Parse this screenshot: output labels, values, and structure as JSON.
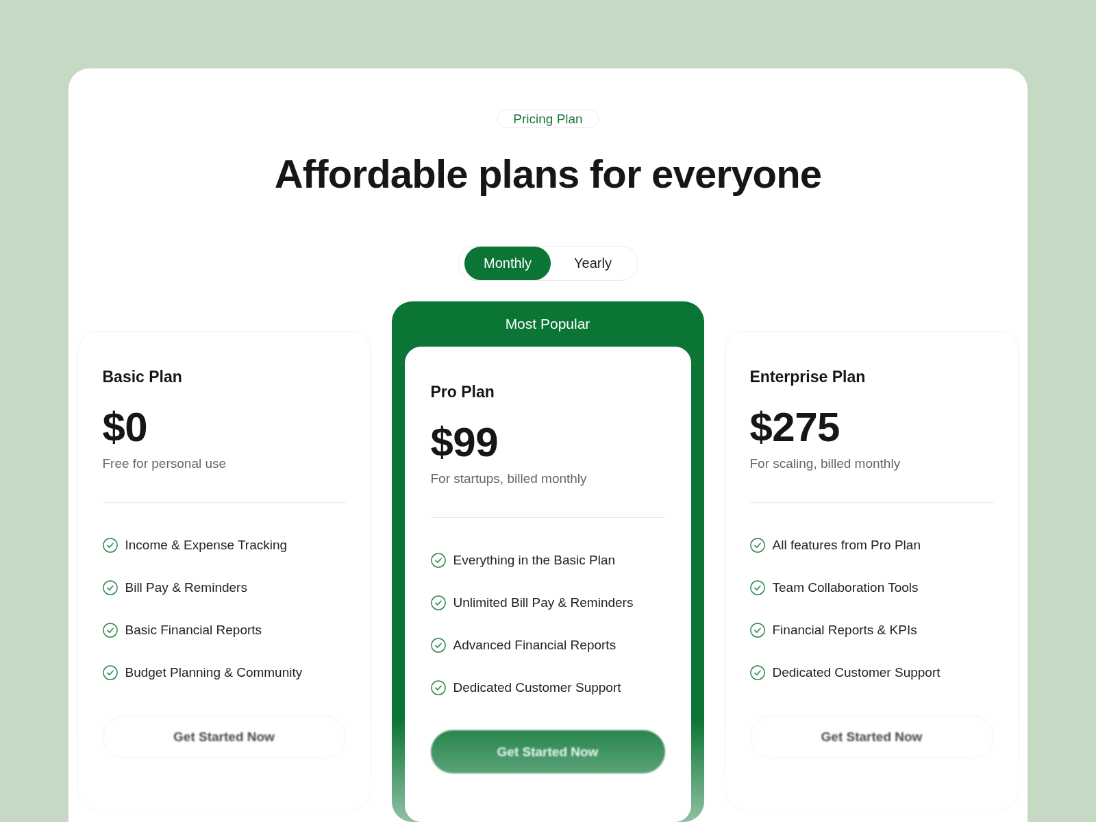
{
  "eyebrow": "Pricing Plan",
  "heading": "Affordable plans for everyone",
  "billing_toggle": [
    {
      "label": "Monthly",
      "selected": true
    },
    {
      "label": "Yearly",
      "selected": false
    }
  ],
  "plans": [
    {
      "featured": false,
      "name": "Basic Plan",
      "price": "$0",
      "note": "Free for personal use",
      "features": [
        "Income & Expense Tracking",
        "Bill Pay & Reminders",
        "Basic Financial Reports",
        "Budget Planning & Community"
      ],
      "button": "Get Started Now"
    },
    {
      "featured": true,
      "badge": "Most Popular",
      "name": "Pro Plan",
      "price": "$99",
      "note": "For startups, billed monthly",
      "features": [
        "Everything in the Basic Plan",
        "Unlimited Bill Pay & Reminders",
        "Advanced Financial Reports",
        "Dedicated Customer Support"
      ],
      "button": "Get Started Now"
    },
    {
      "featured": false,
      "name": "Enterprise Plan",
      "price": "$275",
      "note": "For scaling, billed monthly",
      "features": [
        "All features from Pro Plan",
        "Team Collaboration Tools",
        "Financial Reports & KPIs",
        "Dedicated Customer Support"
      ],
      "button": "Get Started Now"
    }
  ]
}
